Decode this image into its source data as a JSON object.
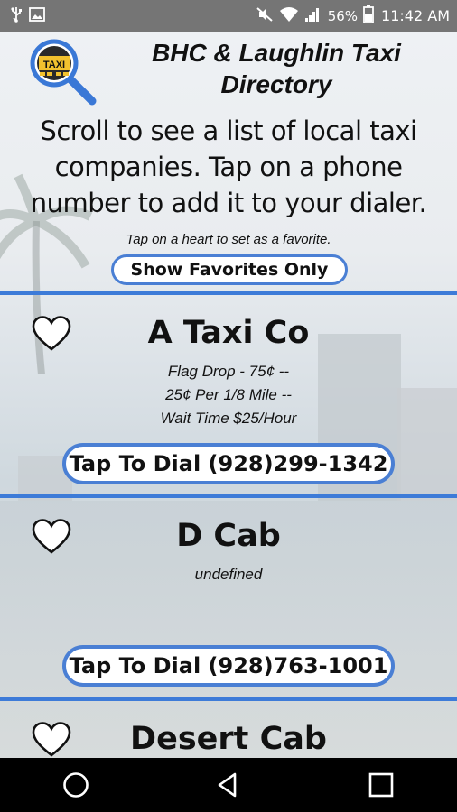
{
  "status_bar": {
    "battery_percent": "56%",
    "time": "11:42 AM",
    "icons": [
      "usb-icon",
      "image-icon",
      "mute-icon",
      "wifi-icon",
      "signal-icon",
      "battery-icon"
    ]
  },
  "header": {
    "logo_text": "TAXI",
    "title": "BHC & Laughlin Taxi Directory",
    "subtitle": "Scroll to see a list of local taxi companies. Tap on a phone number to add it to your dialer.",
    "favorite_hint": "Tap on a heart to set as a favorite.",
    "show_favorites_label": "Show Favorites Only"
  },
  "companies": [
    {
      "name": "A Taxi Co",
      "rates": [
        "Flag Drop - 75¢ --",
        "25¢ Per 1/8 Mile --",
        "Wait Time $25/Hour"
      ],
      "dial_label": "Tap To Dial (928)299-1342"
    },
    {
      "name": "D Cab",
      "rates": [
        "undefined"
      ],
      "dial_label": "Tap To Dial (928)763-1001"
    },
    {
      "name": "Desert Cab"
    }
  ],
  "colors": {
    "accent": "#3d7bd8",
    "status_bar": "#757575",
    "nav_bar": "#000000"
  }
}
